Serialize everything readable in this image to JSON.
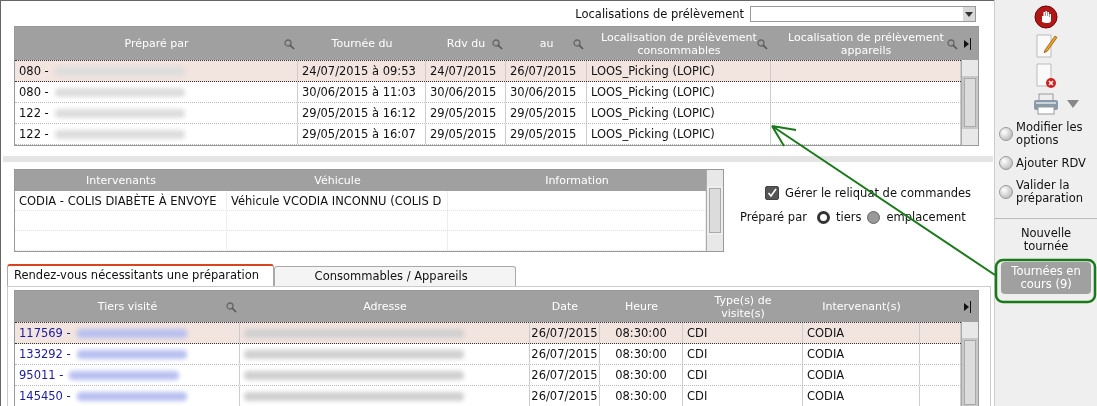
{
  "filter": {
    "label": "Localisations de prélèvement"
  },
  "tournees": {
    "columns": [
      {
        "label": "Préparé par",
        "searchable": true
      },
      {
        "label": "Tournée du",
        "searchable": false
      },
      {
        "label": "Rdv du",
        "searchable": true
      },
      {
        "label": "au",
        "searchable": true
      },
      {
        "label": "Localisation de prélèvement consommables",
        "searchable": true
      },
      {
        "label": "Localisation de prélèvement appareils",
        "searchable": true
      }
    ],
    "rows": [
      {
        "selected": true,
        "redacted": true,
        "cells": [
          "080 -",
          "24/07/2015 à 09:53",
          "24/07/2015",
          "26/07/2015",
          "LOOS_Picking (LOPIC)"
        ]
      },
      {
        "selected": false,
        "redacted": true,
        "cells": [
          "080 -",
          "30/06/2015 à 11:03",
          "30/06/2015",
          "30/06/2015",
          "LOOS_Picking (LOPIC)"
        ]
      },
      {
        "selected": false,
        "redacted": true,
        "cells": [
          "122 -",
          "29/05/2015 à 16:12",
          "29/05/2015",
          "29/05/2015",
          "LOOS_Picking (LOPIC)"
        ]
      },
      {
        "selected": false,
        "redacted": true,
        "cells": [
          "122 -",
          "29/05/2015 à 16:07",
          "29/05/2015",
          "29/05/2015",
          "LOOS_Picking (LOPIC)"
        ]
      }
    ]
  },
  "intervenants": {
    "columns": [
      "Intervenants",
      "Véhicule",
      "Information"
    ],
    "rows": [
      {
        "cells": [
          "CODIA - COLIS DIABÈTE À ENVOYE",
          "Véhicule VCODIA INCONNU (COLIS D"
        ]
      }
    ]
  },
  "options": {
    "remainder": {
      "label": "Gérer le reliquat de commandes",
      "checked": true
    },
    "prepared_by": {
      "label": "Préparé par",
      "choices": [
        {
          "label": "tiers",
          "selected": true
        },
        {
          "label": "emplacement",
          "selected": false
        }
      ]
    }
  },
  "tabs": [
    {
      "label": "Rendez-vous nécessitants une préparation",
      "selected": true
    },
    {
      "label": "Consommables / Appareils",
      "selected": false
    }
  ],
  "rdv": {
    "columns": [
      {
        "label": "Tiers visité",
        "searchable": true
      },
      {
        "label": "Adresse",
        "searchable": false
      },
      {
        "label": "Date",
        "searchable": false
      },
      {
        "label": "Heure",
        "searchable": false
      },
      {
        "label": "Type(s) de visite(s)",
        "searchable": false
      },
      {
        "label": "Intervenant(s)",
        "searchable": false
      }
    ],
    "rows": [
      {
        "selected": true,
        "redacted": true,
        "cells": [
          "117569 -",
          "",
          "26/07/2015",
          "08:30:00",
          "CDI",
          "CODIA"
        ]
      },
      {
        "selected": false,
        "redacted": true,
        "cells": [
          "133292 -",
          "",
          "26/07/2015",
          "08:30:00",
          "CDI",
          "CODIA"
        ]
      },
      {
        "selected": false,
        "redacted": true,
        "cells": [
          "95011 -",
          "",
          "26/07/2015",
          "08:30:00",
          "CDI",
          "CODIA"
        ]
      },
      {
        "selected": false,
        "redacted": true,
        "cells": [
          "145450 -",
          "",
          "26/07/2015",
          "08:30:00",
          "CDI",
          "CODIA"
        ]
      }
    ]
  },
  "sidebar": {
    "actions": [
      {
        "label": "Modifier les options"
      },
      {
        "label": "Ajouter RDV"
      },
      {
        "label": "Valider la préparation"
      }
    ],
    "sections": [
      {
        "label": "Nouvelle tournée",
        "selected": false
      },
      {
        "label": "Tournées en cours  (9)",
        "selected": true
      }
    ]
  }
}
